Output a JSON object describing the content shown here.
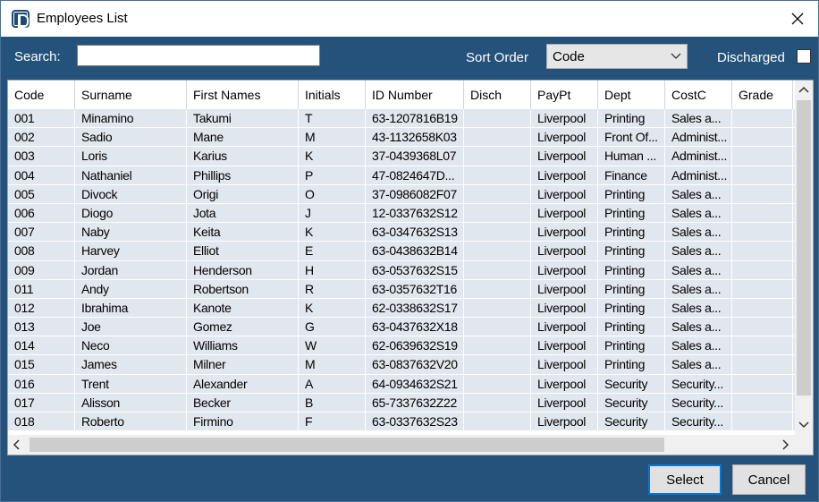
{
  "window": {
    "title": "Employees List"
  },
  "icons": {
    "app": "app-logo-icon",
    "close": "close-icon",
    "dropdown": "chevron-down-icon",
    "scroll_up": "chevron-up-icon",
    "scroll_down": "chevron-down-icon",
    "scroll_left": "chevron-left-icon",
    "scroll_right": "chevron-right-icon"
  },
  "toolbar": {
    "search_label": "Search:",
    "search_value": "",
    "sort_label": "Sort Order",
    "sort_value": "Code",
    "discharged_label": "Discharged",
    "discharged_checked": false
  },
  "table": {
    "columns": [
      "Code",
      "Surname",
      "First Names",
      "Initials",
      "ID Number",
      "Disch",
      "PayPt",
      "Dept",
      "CostC",
      "Grade"
    ],
    "rows": [
      [
        "001",
        "Minamino",
        "Takumi",
        "T",
        "63-1207816B19",
        "",
        "Liverpool",
        "Printing",
        "Sales a...",
        ""
      ],
      [
        "002",
        "Sadio",
        "Mane",
        "M",
        "43-1132658K03",
        "",
        "Liverpool",
        "Front Of...",
        "Administ...",
        ""
      ],
      [
        "003",
        "Loris",
        "Karius",
        "K",
        "37-0439368L07",
        "",
        "Liverpool",
        "Human ...",
        "Administ...",
        ""
      ],
      [
        "004",
        "Nathaniel",
        "Phillips",
        "P",
        "47-0824647D...",
        "",
        "Liverpool",
        "Finance",
        "Administ...",
        ""
      ],
      [
        "005",
        "Divock",
        "Origi",
        "O",
        "37-0986082F07",
        "",
        "Liverpool",
        "Printing",
        "Sales a...",
        ""
      ],
      [
        "006",
        "Diogo",
        "Jota",
        "J",
        "12-0337632S12",
        "",
        "Liverpool",
        "Printing",
        "Sales a...",
        ""
      ],
      [
        "007",
        "Naby",
        "Keita",
        "K",
        "63-0347632S13",
        "",
        "Liverpool",
        "Printing",
        "Sales a...",
        ""
      ],
      [
        "008",
        "Harvey",
        "Elliot",
        "E",
        "63-0438632B14",
        "",
        "Liverpool",
        "Printing",
        "Sales a...",
        ""
      ],
      [
        "009",
        "Jordan",
        "Henderson",
        "H",
        "63-0537632S15",
        "",
        "Liverpool",
        "Printing",
        "Sales a...",
        ""
      ],
      [
        "011",
        "Andy",
        "Robertson",
        "R",
        "63-0357632T16",
        "",
        "Liverpool",
        "Printing",
        "Sales a...",
        ""
      ],
      [
        "012",
        "Ibrahima",
        "Kanote",
        "K",
        "62-0338632S17",
        "",
        "Liverpool",
        "Printing",
        "Sales a...",
        ""
      ],
      [
        "013",
        "Joe",
        "Gomez",
        "G",
        "63-0437632X18",
        "",
        "Liverpool",
        "Printing",
        "Sales a...",
        ""
      ],
      [
        "014",
        "Neco",
        "Williams",
        "W",
        "62-0639632S19",
        "",
        "Liverpool",
        "Printing",
        "Sales a...",
        ""
      ],
      [
        "015",
        "James",
        "Milner",
        "M",
        "63-0837632V20",
        "",
        "Liverpool",
        "Printing",
        "Sales a...",
        ""
      ],
      [
        "016",
        "Trent",
        "Alexander",
        "A",
        "64-0934632S21",
        "",
        "Liverpool",
        "Security",
        "Security...",
        ""
      ],
      [
        "017",
        "Alisson",
        "Becker",
        "B",
        "65-7337632Z22",
        "",
        "Liverpool",
        "Security",
        "Security...",
        ""
      ],
      [
        "018",
        "Roberto",
        "Firmino",
        "F",
        "63-0337632S23",
        "",
        "Liverpool",
        "Security",
        "Security...",
        ""
      ]
    ]
  },
  "buttons": {
    "select": "Select",
    "cancel": "Cancel"
  },
  "colors": {
    "frame": "#25527a",
    "row_bg": "#e1e7ee",
    "select_border": "#0078d7"
  }
}
